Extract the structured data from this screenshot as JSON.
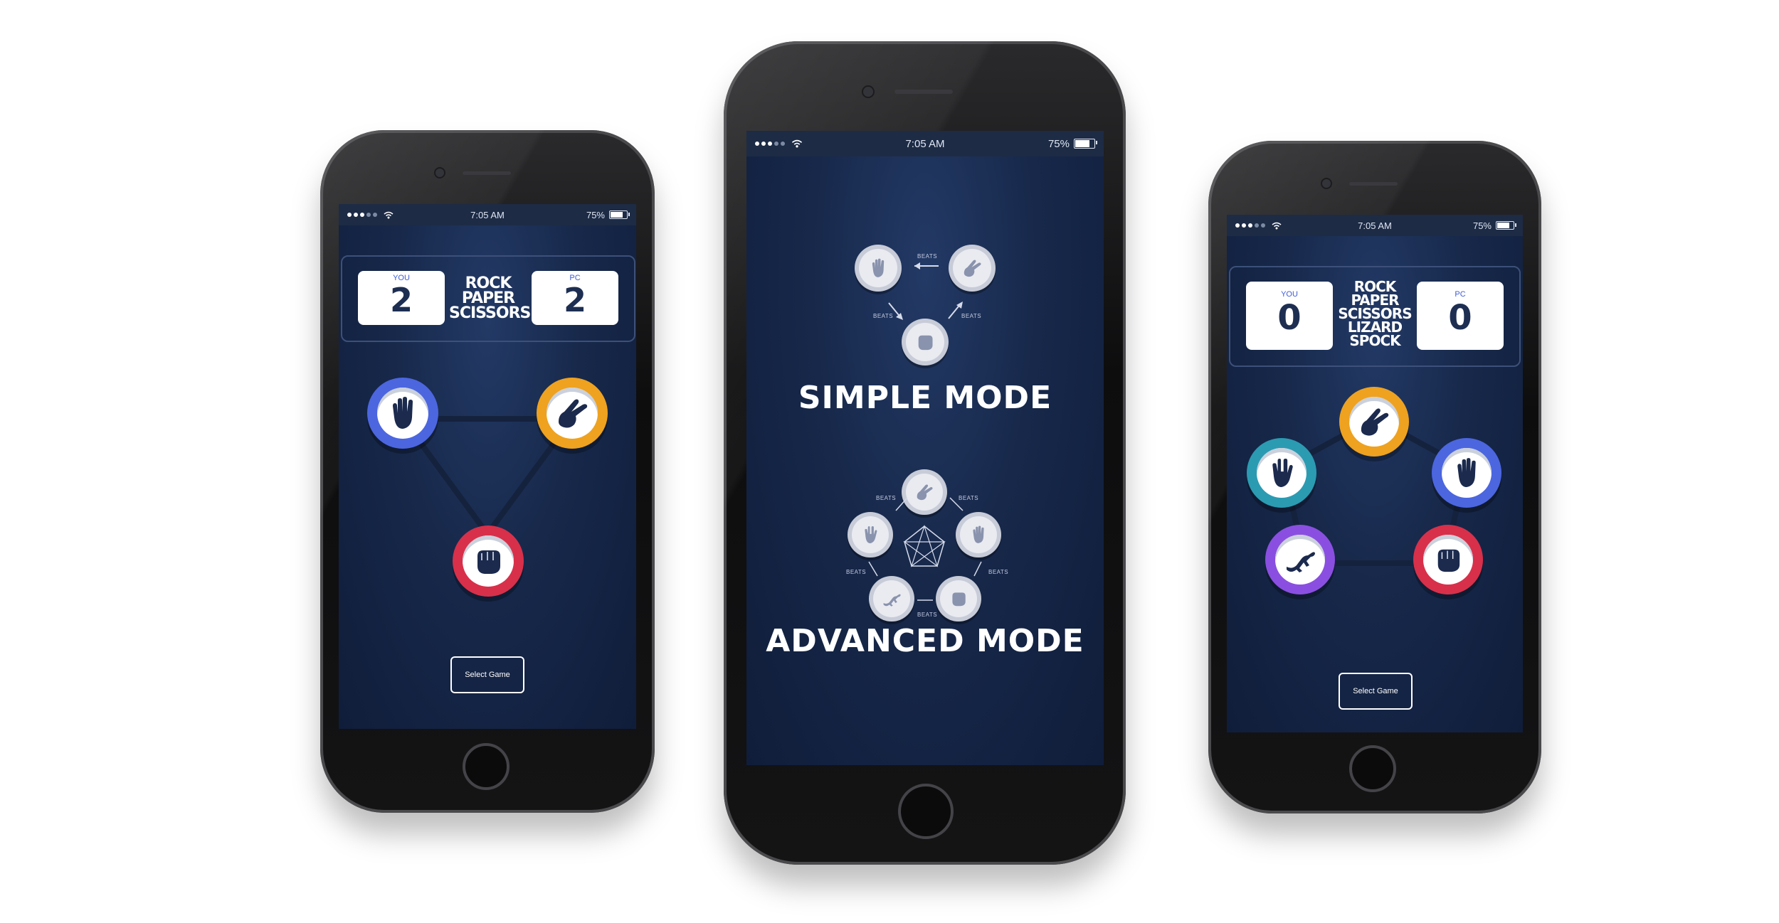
{
  "status_bar": {
    "time": "7:05 AM",
    "battery": "75%",
    "battery_level": 0.75
  },
  "left_phone": {
    "player_label": "YOU",
    "player_score": "2",
    "pc_label": "PC",
    "pc_score": "2",
    "game_title": [
      "ROCK",
      "PAPER",
      "SCISSORS"
    ],
    "select_button": "Select Game",
    "choices": [
      {
        "name": "paper",
        "icon": "paper-hand-icon",
        "ring_color": "#4c66e0"
      },
      {
        "name": "scissors",
        "icon": "scissors-hand-icon",
        "ring_color": "#eea21f"
      },
      {
        "name": "rock",
        "icon": "rock-fist-icon",
        "ring_color": "#d8304a"
      }
    ]
  },
  "center_phone": {
    "simple_mode_label": "SIMPLE MODE",
    "advanced_mode_label": "ADVANCED MODE",
    "beats_label": "BEATS"
  },
  "right_phone": {
    "player_label": "YOU",
    "player_score": "0",
    "pc_label": "PC",
    "pc_score": "0",
    "game_title": [
      "ROCK",
      "PAPER",
      "SCISSORS",
      "LIZARD",
      "SPOCK"
    ],
    "select_button": "Select Game",
    "choices": [
      {
        "name": "scissors",
        "icon": "scissors-hand-icon",
        "ring_color": "#eea21f"
      },
      {
        "name": "spock",
        "icon": "spock-hand-icon",
        "ring_color": "#2b9bb2"
      },
      {
        "name": "paper",
        "icon": "paper-hand-icon",
        "ring_color": "#4c66e0"
      },
      {
        "name": "lizard",
        "icon": "lizard-icon",
        "ring_color": "#8a4fe0"
      },
      {
        "name": "rock",
        "icon": "rock-fist-icon",
        "ring_color": "#d8304a"
      }
    ]
  },
  "colors": {
    "background": "#101d3a",
    "score_text": "#1d2e52",
    "you_label": "#3f5dd4"
  }
}
